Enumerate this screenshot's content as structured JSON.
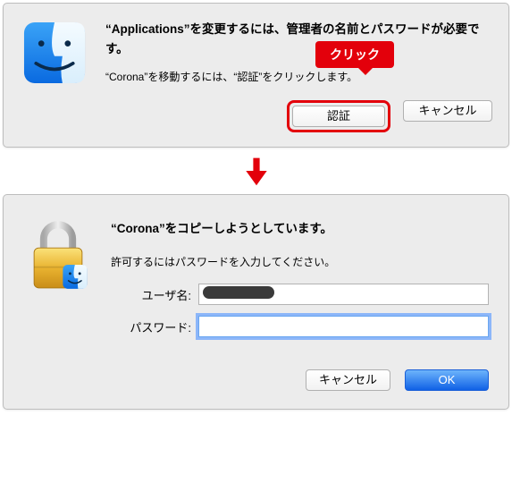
{
  "dialog1": {
    "title": "“Applications”を変更するには、管理者の名前とパスワードが必要です。",
    "description": "“Corona”を移動するには、“認証”をクリックします。",
    "btn_authenticate": "認証",
    "btn_cancel": "キャンセル"
  },
  "callout": {
    "label": "クリック"
  },
  "dialog2": {
    "title": "“Corona”をコピーしようとしています。",
    "description": "許可するにはパスワードを入力してください。",
    "label_username": "ユーザ名:",
    "label_password": "パスワード:",
    "value_username": "",
    "value_password": "",
    "btn_cancel": "キャンセル",
    "btn_ok": "OK"
  },
  "colors": {
    "accent_red": "#e3000b",
    "primary_blue": "#1a6ef0"
  }
}
